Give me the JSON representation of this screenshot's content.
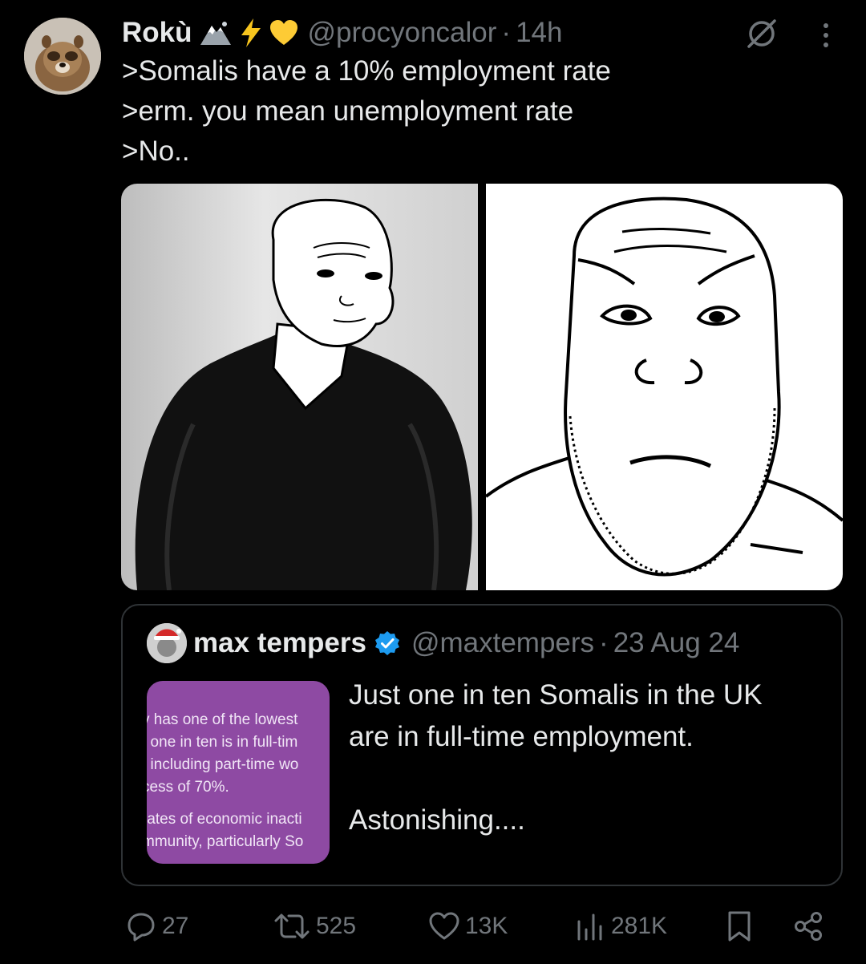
{
  "tweet": {
    "display_name": "Rokù",
    "emojis": [
      "mountain-icon",
      "lightning-icon",
      "yellow-heart-icon"
    ],
    "handle": "@procyoncalor",
    "separator": "·",
    "time": "14h",
    "text_lines": [
      ">Somalis have a 10% employment rate",
      ">erm. you mean unemployment rate",
      ">No.."
    ]
  },
  "quote": {
    "display_name": "max tempers",
    "handle": "@maxtempers",
    "separator": "·",
    "date": "23 Aug 24",
    "text_lines": [
      "Just one in ten Somalis in the UK",
      "are in full-time employment.",
      "",
      "Astonishing...."
    ],
    "thumbnail_lines": [
      "y has one of the lowest",
      "t one in ten is in full-tim",
      ", including part-time wo",
      "cess of 70%.",
      "rates of economic inacti",
      "mmunity, particularly So"
    ]
  },
  "actions": {
    "replies": "27",
    "reposts": "525",
    "likes": "13K",
    "views": "281K"
  },
  "colors": {
    "background": "#000000",
    "text": "#e7e9ea",
    "secondary": "#71767b",
    "border": "#2f3336",
    "verified": "#1d9bf0",
    "thumbnail": "#8e4aa3"
  }
}
